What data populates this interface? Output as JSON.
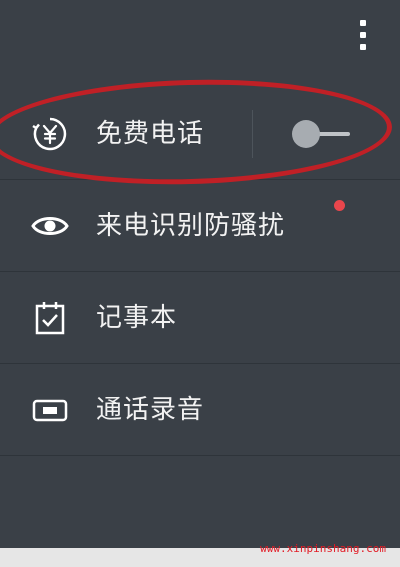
{
  "menu": {
    "items": [
      {
        "label": "免费电话",
        "icon": "yuan-refresh-icon",
        "toggle_on": false
      },
      {
        "label": "来电识别防骚扰",
        "icon": "eye-icon",
        "badge": true
      },
      {
        "label": "记事本",
        "icon": "notepad-icon"
      },
      {
        "label": "通话录音",
        "icon": "record-icon"
      }
    ]
  },
  "watermark": {
    "text": "www.xinpinshang.com"
  },
  "colors": {
    "background": "#3a4047",
    "highlight": "#c02026",
    "badge": "#e9464c"
  }
}
